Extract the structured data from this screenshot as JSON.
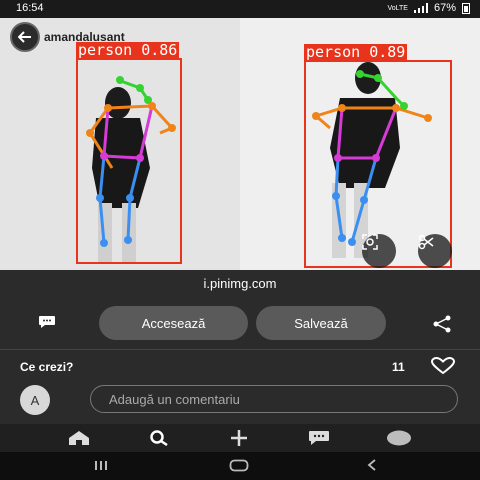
{
  "status_bar": {
    "time": "16:54",
    "battery": "67%",
    "network": "VoLTE"
  },
  "header": {
    "username": "amandalusant",
    "back_icon": "back-arrow-icon"
  },
  "detections": [
    {
      "label": "person 0.86"
    },
    {
      "label": "person 0.89"
    }
  ],
  "image_tools": {
    "lens_icon": "visual-search-icon",
    "cut_icon": "scissors-icon"
  },
  "source": "i.pinimg.com",
  "actions": {
    "visit_label": "Accesează",
    "save_label": "Salvează",
    "comment_icon": "comment-bubble-icon",
    "share_icon": "share-icon"
  },
  "comments": {
    "prompt": "Ce crezi?",
    "likes_count": "11",
    "avatar_letter": "A",
    "input_placeholder": "Adaugă un comentariu"
  },
  "bottom_nav": [
    "home-icon",
    "search-icon",
    "add-icon",
    "messages-icon",
    "profile-icon"
  ],
  "colors": {
    "detection_box": "#e8341c",
    "button_bg": "#5a5a5a",
    "background": "#2b2b2b"
  }
}
